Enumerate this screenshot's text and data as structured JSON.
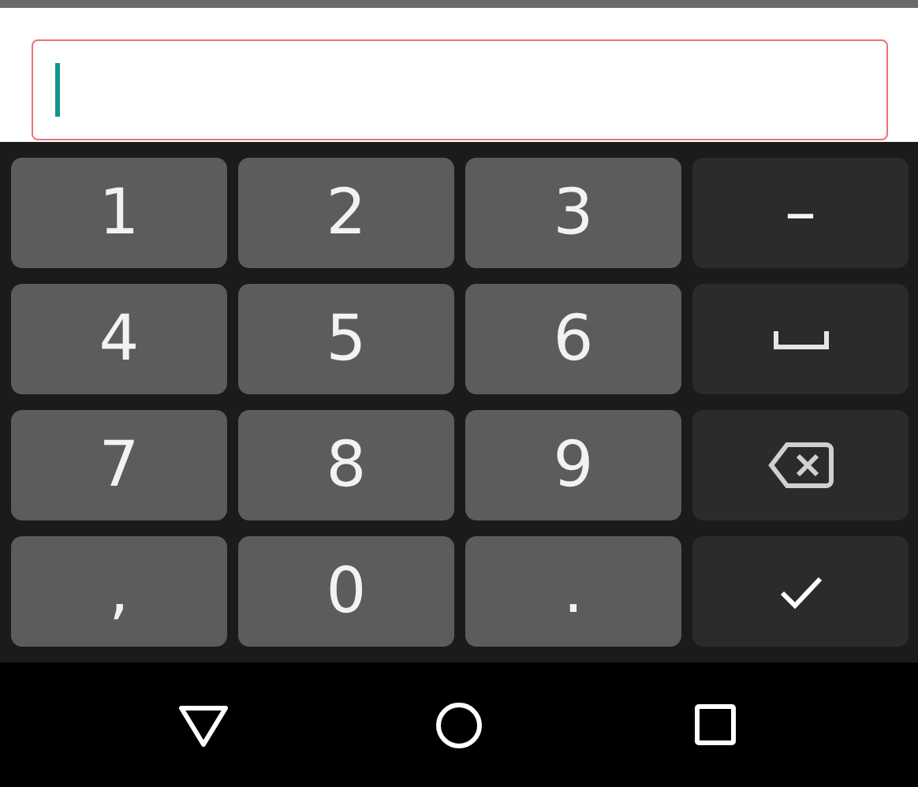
{
  "text_field": {
    "focused": true,
    "error": true
  },
  "keys": [
    {
      "kind": "digit",
      "label": "1"
    },
    {
      "kind": "digit",
      "label": "2"
    },
    {
      "kind": "digit",
      "label": "3"
    },
    {
      "kind": "function",
      "label": "–"
    },
    {
      "kind": "digit",
      "label": "4"
    },
    {
      "kind": "digit",
      "label": "5"
    },
    {
      "kind": "digit",
      "label": "6"
    },
    {
      "kind": "space"
    },
    {
      "kind": "digit",
      "label": "7"
    },
    {
      "kind": "digit",
      "label": "8"
    },
    {
      "kind": "digit",
      "label": "9"
    },
    {
      "kind": "backspace"
    },
    {
      "kind": "digit",
      "label": ","
    },
    {
      "kind": "digit",
      "label": "0"
    },
    {
      "kind": "digit",
      "label": "."
    },
    {
      "kind": "enter"
    }
  ],
  "nav_bar": [
    {
      "kind": "back"
    },
    {
      "kind": "home"
    },
    {
      "kind": "recents"
    }
  ]
}
